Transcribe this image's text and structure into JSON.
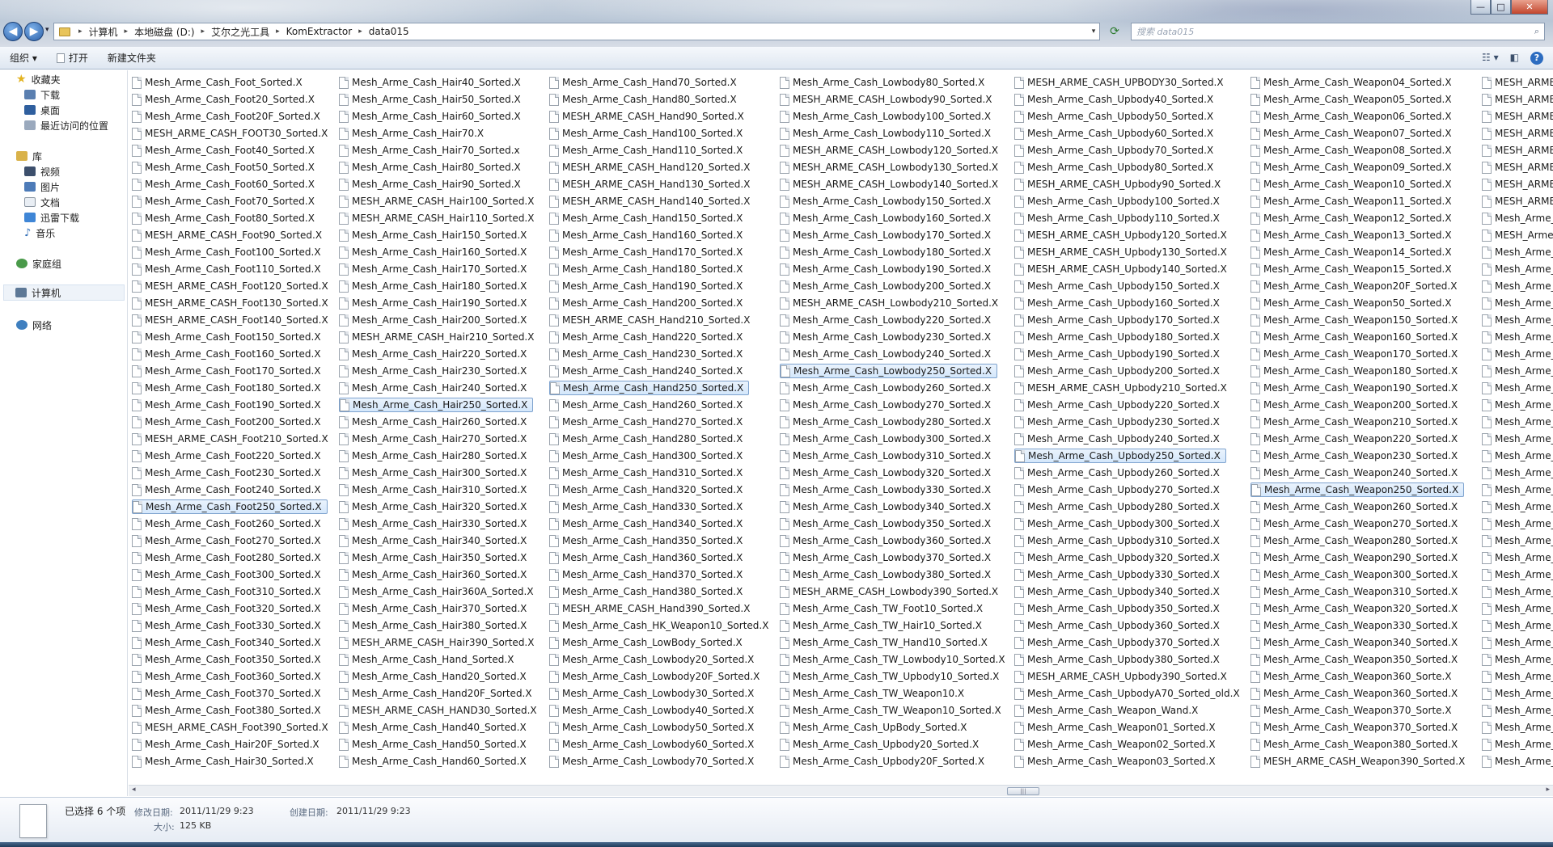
{
  "window": {
    "min_label": "—",
    "max_label": "□",
    "close_label": "✕"
  },
  "nav_buttons": {
    "back": "◀",
    "forward": "▶",
    "history": "▾"
  },
  "address": {
    "crumbs": [
      "计算机",
      "本地磁盘 (D:)",
      "艾尔之光工具",
      "KomExtractor",
      "data015"
    ],
    "separator": "▸",
    "dropdown": "▾"
  },
  "search": {
    "placeholder": "搜索 data015",
    "icon": "⌕"
  },
  "toolbar": {
    "organize": "组织 ▾",
    "open": "打开",
    "new_folder": "新建文件夹",
    "view_icon": "☷ ▾",
    "pane_icon": "◧",
    "help_icon": "?"
  },
  "nav": {
    "favorites": "收藏夹",
    "downloads": "下载",
    "desktop": "桌面",
    "recent": "最近访问的位置",
    "libraries": "库",
    "videos": "视频",
    "pictures": "图片",
    "documents": "文档",
    "thunder": "迅雷下载",
    "music": "音乐",
    "homegroup": "家庭组",
    "computer": "计算机",
    "network": "网络"
  },
  "files": {
    "col1": [
      "Mesh_Arme_Cash_Foot_Sorted.X",
      "Mesh_Arme_Cash_Foot20_Sorted.X",
      "Mesh_Arme_Cash_Foot20F_Sorted.X",
      "MESH_ARME_CASH_FOOT30_Sorted.X",
      "Mesh_Arme_Cash_Foot40_Sorted.X",
      "Mesh_Arme_Cash_Foot50_Sorted.X",
      "Mesh_Arme_Cash_Foot60_Sorted.X",
      "Mesh_Arme_Cash_Foot70_Sorted.X",
      "Mesh_Arme_Cash_Foot80_Sorted.X",
      "MESH_ARME_CASH_Foot90_Sorted.X",
      "Mesh_Arme_Cash_Foot100_Sorted.X",
      "Mesh_Arme_Cash_Foot110_Sorted.X",
      "MESH_ARME_CASH_Foot120_Sorted.X",
      "MESH_ARME_CASH_Foot130_Sorted.X",
      "MESH_ARME_CASH_Foot140_Sorted.X",
      "Mesh_Arme_Cash_Foot150_Sorted.X",
      "Mesh_Arme_Cash_Foot160_Sorted.X",
      "Mesh_Arme_Cash_Foot170_Sorted.X",
      "Mesh_Arme_Cash_Foot180_Sorted.X",
      "Mesh_Arme_Cash_Foot190_Sorted.X",
      "Mesh_Arme_Cash_Foot200_Sorted.X",
      "MESH_ARME_CASH_Foot210_Sorted.X",
      "Mesh_Arme_Cash_Foot220_Sorted.X",
      "Mesh_Arme_Cash_Foot230_Sorted.X",
      "Mesh_Arme_Cash_Foot240_Sorted.X",
      "Mesh_Arme_Cash_Foot250_Sorted.X",
      "Mesh_Arme_Cash_Foot260_Sorted.X",
      "Mesh_Arme_Cash_Foot270_Sorted.X",
      "Mesh_Arme_Cash_Foot280_Sorted.X",
      "Mesh_Arme_Cash_Foot300_Sorted.X",
      "Mesh_Arme_Cash_Foot310_Sorted.X",
      "Mesh_Arme_Cash_Foot320_Sorted.X",
      "Mesh_Arme_Cash_Foot330_Sorted.X",
      "Mesh_Arme_Cash_Foot340_Sorted.X",
      "Mesh_Arme_Cash_Foot350_Sorted.X",
      "Mesh_Arme_Cash_Foot360_Sorted.X",
      "Mesh_Arme_Cash_Foot370_Sorted.X",
      "Mesh_Arme_Cash_Foot380_Sorted.X",
      "MESH_ARME_CASH_Foot390_Sorted.X",
      "Mesh_Arme_Cash_Hair20F_Sorted.X",
      "Mesh_Arme_Cash_Hair30_Sorted.X"
    ],
    "col2": [
      "Mesh_Arme_Cash_Hair40_Sorted.X",
      "Mesh_Arme_Cash_Hair50_Sorted.X",
      "Mesh_Arme_Cash_Hair60_Sorted.X",
      "Mesh_Arme_Cash_Hair70.X",
      "Mesh_Arme_Cash_Hair70_Sorted.x",
      "Mesh_Arme_Cash_Hair80_Sorted.X",
      "Mesh_Arme_Cash_Hair90_Sorted.X",
      "MESH_ARME_CASH_Hair100_Sorted.X",
      "MESH_ARME_CASH_Hair110_Sorted.X",
      "Mesh_Arme_Cash_Hair150_Sorted.X",
      "Mesh_Arme_Cash_Hair160_Sorted.X",
      "Mesh_Arme_Cash_Hair170_Sorted.X",
      "Mesh_Arme_Cash_Hair180_Sorted.X",
      "Mesh_Arme_Cash_Hair190_Sorted.X",
      "Mesh_Arme_Cash_Hair200_Sorted.X",
      "MESH_ARME_CASH_Hair210_Sorted.X",
      "Mesh_Arme_Cash_Hair220_Sorted.X",
      "Mesh_Arme_Cash_Hair230_Sorted.X",
      "Mesh_Arme_Cash_Hair240_Sorted.X",
      "Mesh_Arme_Cash_Hair250_Sorted.X",
      "Mesh_Arme_Cash_Hair260_Sorted.X",
      "Mesh_Arme_Cash_Hair270_Sorted.X",
      "Mesh_Arme_Cash_Hair280_Sorted.X",
      "Mesh_Arme_Cash_Hair300_Sorted.X",
      "Mesh_Arme_Cash_Hair310_Sorted.X",
      "Mesh_Arme_Cash_Hair320_Sorted.X",
      "Mesh_Arme_Cash_Hair330_Sorted.X",
      "Mesh_Arme_Cash_Hair340_Sorted.X",
      "Mesh_Arme_Cash_Hair350_Sorted.X",
      "Mesh_Arme_Cash_Hair360_Sorted.X",
      "Mesh_Arme_Cash_Hair360A_Sorted.X",
      "Mesh_Arme_Cash_Hair370_Sorted.X",
      "Mesh_Arme_Cash_Hair380_Sorted.X",
      "MESH_ARME_CASH_Hair390_Sorted.X",
      "Mesh_Arme_Cash_Hand_Sorted.X",
      "Mesh_Arme_Cash_Hand20_Sorted.X",
      "Mesh_Arme_Cash_Hand20F_Sorted.X",
      "MESH_ARME_CASH_HAND30_Sorted.X",
      "Mesh_Arme_Cash_Hand40_Sorted.X",
      "Mesh_Arme_Cash_Hand50_Sorted.X",
      "Mesh_Arme_Cash_Hand60_Sorted.X"
    ],
    "col3": [
      "Mesh_Arme_Cash_Hand70_Sorted.X",
      "Mesh_Arme_Cash_Hand80_Sorted.X",
      "MESH_ARME_CASH_Hand90_Sorted.X",
      "Mesh_Arme_Cash_Hand100_Sorted.X",
      "Mesh_Arme_Cash_Hand110_Sorted.X",
      "MESH_ARME_CASH_Hand120_Sorted.X",
      "MESH_ARME_CASH_Hand130_Sorted.X",
      "MESH_ARME_CASH_Hand140_Sorted.X",
      "Mesh_Arme_Cash_Hand150_Sorted.X",
      "Mesh_Arme_Cash_Hand160_Sorted.X",
      "Mesh_Arme_Cash_Hand170_Sorted.X",
      "Mesh_Arme_Cash_Hand180_Sorted.X",
      "Mesh_Arme_Cash_Hand190_Sorted.X",
      "Mesh_Arme_Cash_Hand200_Sorted.X",
      "MESH_ARME_CASH_Hand210_Sorted.X",
      "Mesh_Arme_Cash_Hand220_Sorted.X",
      "Mesh_Arme_Cash_Hand230_Sorted.X",
      "Mesh_Arme_Cash_Hand240_Sorted.X",
      "Mesh_Arme_Cash_Hand250_Sorted.X",
      "Mesh_Arme_Cash_Hand260_Sorted.X",
      "Mesh_Arme_Cash_Hand270_Sorted.X",
      "Mesh_Arme_Cash_Hand280_Sorted.X",
      "Mesh_Arme_Cash_Hand300_Sorted.X",
      "Mesh_Arme_Cash_Hand310_Sorted.X",
      "Mesh_Arme_Cash_Hand320_Sorted.X",
      "Mesh_Arme_Cash_Hand330_Sorted.X",
      "Mesh_Arme_Cash_Hand340_Sorted.X",
      "Mesh_Arme_Cash_Hand350_Sorted.X",
      "Mesh_Arme_Cash_Hand360_Sorted.X",
      "Mesh_Arme_Cash_Hand370_Sorted.X",
      "Mesh_Arme_Cash_Hand380_Sorted.X",
      "MESH_ARME_CASH_Hand390_Sorted.X",
      "Mesh_Arme_Cash_HK_Weapon10_Sorted.X",
      "Mesh_Arme_Cash_LowBody_Sorted.X",
      "Mesh_Arme_Cash_Lowbody20_Sorted.X",
      "Mesh_Arme_Cash_Lowbody20F_Sorted.X",
      "Mesh_Arme_Cash_Lowbody30_Sorted.X",
      "Mesh_Arme_Cash_Lowbody40_Sorted.X",
      "Mesh_Arme_Cash_Lowbody50_Sorted.X",
      "Mesh_Arme_Cash_Lowbody60_Sorted.X",
      "Mesh_Arme_Cash_Lowbody70_Sorted.X"
    ],
    "col4": [
      "Mesh_Arme_Cash_Lowbody80_Sorted.X",
      "MESH_ARME_CASH_Lowbody90_Sorted.X",
      "Mesh_Arme_Cash_Lowbody100_Sorted.X",
      "Mesh_Arme_Cash_Lowbody110_Sorted.X",
      "MESH_ARME_CASH_Lowbody120_Sorted.X",
      "MESH_ARME_CASH_Lowbody130_Sorted.X",
      "MESH_ARME_CASH_Lowbody140_Sorted.X",
      "Mesh_Arme_Cash_Lowbody150_Sorted.X",
      "Mesh_Arme_Cash_Lowbody160_Sorted.X",
      "Mesh_Arme_Cash_Lowbody170_Sorted.X",
      "Mesh_Arme_Cash_Lowbody180_Sorted.X",
      "Mesh_Arme_Cash_Lowbody190_Sorted.X",
      "Mesh_Arme_Cash_Lowbody200_Sorted.X",
      "MESH_ARME_CASH_Lowbody210_Sorted.X",
      "Mesh_Arme_Cash_Lowbody220_Sorted.X",
      "Mesh_Arme_Cash_Lowbody230_Sorted.X",
      "Mesh_Arme_Cash_Lowbody240_Sorted.X",
      "Mesh_Arme_Cash_Lowbody250_Sorted.X",
      "Mesh_Arme_Cash_Lowbody260_Sorted.X",
      "Mesh_Arme_Cash_Lowbody270_Sorted.X",
      "Mesh_Arme_Cash_Lowbody280_Sorted.X",
      "Mesh_Arme_Cash_Lowbody300_Sorted.X",
      "Mesh_Arme_Cash_Lowbody310_Sorted.X",
      "Mesh_Arme_Cash_Lowbody320_Sorted.X",
      "Mesh_Arme_Cash_Lowbody330_Sorted.X",
      "Mesh_Arme_Cash_Lowbody340_Sorted.X",
      "Mesh_Arme_Cash_Lowbody350_Sorted.X",
      "Mesh_Arme_Cash_Lowbody360_Sorted.X",
      "Mesh_Arme_Cash_Lowbody370_Sorted.X",
      "Mesh_Arme_Cash_Lowbody380_Sorted.X",
      "MESH_ARME_CASH_Lowbody390_Sorted.X",
      "Mesh_Arme_Cash_TW_Foot10_Sorted.X",
      "Mesh_Arme_Cash_TW_Hair10_Sorted.X",
      "Mesh_Arme_Cash_TW_Hand10_Sorted.X",
      "Mesh_Arme_Cash_TW_Lowbody10_Sorted.X",
      "Mesh_Arme_Cash_TW_Upbody10_Sorted.X",
      "Mesh_Arme_Cash_TW_Weapon10.X",
      "Mesh_Arme_Cash_TW_Weapon10_Sorted.X",
      "Mesh_Arme_Cash_UpBody_Sorted.X",
      "Mesh_Arme_Cash_Upbody20_Sorted.X",
      "Mesh_Arme_Cash_Upbody20F_Sorted.X"
    ],
    "col5": [
      "MESH_ARME_CASH_UPBODY30_Sorted.X",
      "Mesh_Arme_Cash_Upbody40_Sorted.X",
      "Mesh_Arme_Cash_Upbody50_Sorted.X",
      "Mesh_Arme_Cash_Upbody60_Sorted.X",
      "Mesh_Arme_Cash_Upbody70_Sorted.X",
      "Mesh_Arme_Cash_Upbody80_Sorted.X",
      "MESH_ARME_CASH_Upbody90_Sorted.X",
      "Mesh_Arme_Cash_Upbody100_Sorted.X",
      "Mesh_Arme_Cash_Upbody110_Sorted.X",
      "MESH_ARME_CASH_Upbody120_Sorted.X",
      "MESH_ARME_CASH_Upbody130_Sorted.X",
      "MESH_ARME_CASH_Upbody140_Sorted.X",
      "Mesh_Arme_Cash_Upbody150_Sorted.X",
      "Mesh_Arme_Cash_Upbody160_Sorted.X",
      "Mesh_Arme_Cash_Upbody170_Sorted.X",
      "Mesh_Arme_Cash_Upbody180_Sorted.X",
      "Mesh_Arme_Cash_Upbody190_Sorted.X",
      "Mesh_Arme_Cash_Upbody200_Sorted.X",
      "MESH_ARME_CASH_Upbody210_Sorted.X",
      "Mesh_Arme_Cash_Upbody220_Sorted.X",
      "Mesh_Arme_Cash_Upbody230_Sorted.X",
      "Mesh_Arme_Cash_Upbody240_Sorted.X",
      "Mesh_Arme_Cash_Upbody250_Sorted.X",
      "Mesh_Arme_Cash_Upbody260_Sorted.X",
      "Mesh_Arme_Cash_Upbody270_Sorted.X",
      "Mesh_Arme_Cash_Upbody280_Sorted.X",
      "Mesh_Arme_Cash_Upbody300_Sorted.X",
      "Mesh_Arme_Cash_Upbody310_Sorted.X",
      "Mesh_Arme_Cash_Upbody320_Sorted.X",
      "Mesh_Arme_Cash_Upbody330_Sorted.X",
      "Mesh_Arme_Cash_Upbody340_Sorted.X",
      "Mesh_Arme_Cash_Upbody350_Sorted.X",
      "Mesh_Arme_Cash_Upbody360_Sorted.X",
      "Mesh_Arme_Cash_Upbody370_Sorted.X",
      "Mesh_Arme_Cash_Upbody380_Sorted.X",
      "MESH_ARME_CASH_Upbody390_Sorted.X",
      "Mesh_Arme_Cash_UpbodyA70_Sorted_old.X",
      "Mesh_Arme_Cash_Weapon_Wand.X",
      "Mesh_Arme_Cash_Weapon01_Sorted.X",
      "Mesh_Arme_Cash_Weapon02_Sorted.X",
      "Mesh_Arme_Cash_Weapon03_Sorted.X"
    ],
    "col6": [
      "Mesh_Arme_Cash_Weapon04_Sorted.X",
      "Mesh_Arme_Cash_Weapon05_Sorted.X",
      "Mesh_Arme_Cash_Weapon06_Sorted.X",
      "Mesh_Arme_Cash_Weapon07_Sorted.X",
      "Mesh_Arme_Cash_Weapon08_Sorted.X",
      "Mesh_Arme_Cash_Weapon09_Sorted.X",
      "Mesh_Arme_Cash_Weapon10_Sorted.X",
      "Mesh_Arme_Cash_Weapon11_Sorted.X",
      "Mesh_Arme_Cash_Weapon12_Sorted.X",
      "Mesh_Arme_Cash_Weapon13_Sorted.X",
      "Mesh_Arme_Cash_Weapon14_Sorted.X",
      "Mesh_Arme_Cash_Weapon15_Sorted.X",
      "Mesh_Arme_Cash_Weapon20F_Sorted.X",
      "Mesh_Arme_Cash_Weapon50_Sorted.X",
      "Mesh_Arme_Cash_Weapon150_Sorted.X",
      "Mesh_Arme_Cash_Weapon160_Sorted.X",
      "Mesh_Arme_Cash_Weapon170_Sorted.X",
      "Mesh_Arme_Cash_Weapon180_Sorted.X",
      "Mesh_Arme_Cash_Weapon190_Sorted.X",
      "Mesh_Arme_Cash_Weapon200_Sorted.X",
      "Mesh_Arme_Cash_Weapon210_Sorted.X",
      "Mesh_Arme_Cash_Weapon220_Sorted.X",
      "Mesh_Arme_Cash_Weapon230_Sorted.X",
      "Mesh_Arme_Cash_Weapon240_Sorted.X",
      "Mesh_Arme_Cash_Weapon250_Sorted.X",
      "Mesh_Arme_Cash_Weapon260_Sorted.X",
      "Mesh_Arme_Cash_Weapon270_Sorted.X",
      "Mesh_Arme_Cash_Weapon280_Sorted.X",
      "Mesh_Arme_Cash_Weapon290_Sorted.X",
      "Mesh_Arme_Cash_Weapon300_Sorted.X",
      "Mesh_Arme_Cash_Weapon310_Sorted.X",
      "Mesh_Arme_Cash_Weapon320_Sorted.X",
      "Mesh_Arme_Cash_Weapon330_Sorted.X",
      "Mesh_Arme_Cash_Weapon340_Sorted.X",
      "Mesh_Arme_Cash_Weapon350_Sorted.X",
      "Mesh_Arme_Cash_Weapon360_Sorte.X",
      "Mesh_Arme_Cash_Weapon360_Sorted.X",
      "Mesh_Arme_Cash_Weapon370_Sorte.X",
      "Mesh_Arme_Cash_Weapon370_Sorted.X",
      "Mesh_Arme_Cash_Weapon380_Sorted.X",
      "MESH_ARME_CASH_Weapon390_Sorted.X"
    ],
    "col7": [
      "MESH_ARME",
      "MESH_ARME",
      "MESH_ARME",
      "MESH_ARME",
      "MESH_ARME",
      "MESH_ARME",
      "MESH_ARME",
      "MESH_ARME",
      "Mesh_Arme_",
      "MESH_Arme_",
      "Mesh_Arme_",
      "Mesh_Arme_",
      "Mesh_Arme_",
      "Mesh_Arme_",
      "Mesh_Arme_",
      "Mesh_Arme_",
      "Mesh_Arme_",
      "Mesh_Arme_",
      "Mesh_Arme_",
      "Mesh_Arme_",
      "Mesh_Arme_",
      "Mesh_Arme_",
      "Mesh_Arme_",
      "Mesh_Arme_",
      "Mesh_Arme_",
      "Mesh_Arme_",
      "Mesh_Arme_",
      "Mesh_Arme_",
      "Mesh_Arme_",
      "Mesh_Arme_",
      "Mesh_Arme_",
      "Mesh_Arme_",
      "Mesh_Arme_",
      "Mesh_Arme_",
      "Mesh_Arme_",
      "Mesh_Arme_",
      "Mesh_Arme_",
      "Mesh_Arme_",
      "Mesh_Arme_",
      "Mesh_Arme_",
      "Mesh_Arme_"
    ],
    "selected": {
      "col1": 25,
      "col2": 19,
      "col3": 18,
      "col4": 17,
      "col5": 22,
      "col6": 24
    }
  },
  "scrollbar": {
    "left": "◂",
    "right": "▸",
    "grip": "|||"
  },
  "details": {
    "selected_count": "已选择 6 个项",
    "modified_label": "修改日期:",
    "modified_value": "2011/11/29 9:23",
    "created_label": "创建日期:",
    "created_value": "2011/11/29 9:23",
    "size_label": "大小:",
    "size_value": "125 KB"
  },
  "colors": {
    "accent": "#3b6ea5",
    "selection": "#d4e7fb",
    "selection_border": "#7da2ce"
  }
}
